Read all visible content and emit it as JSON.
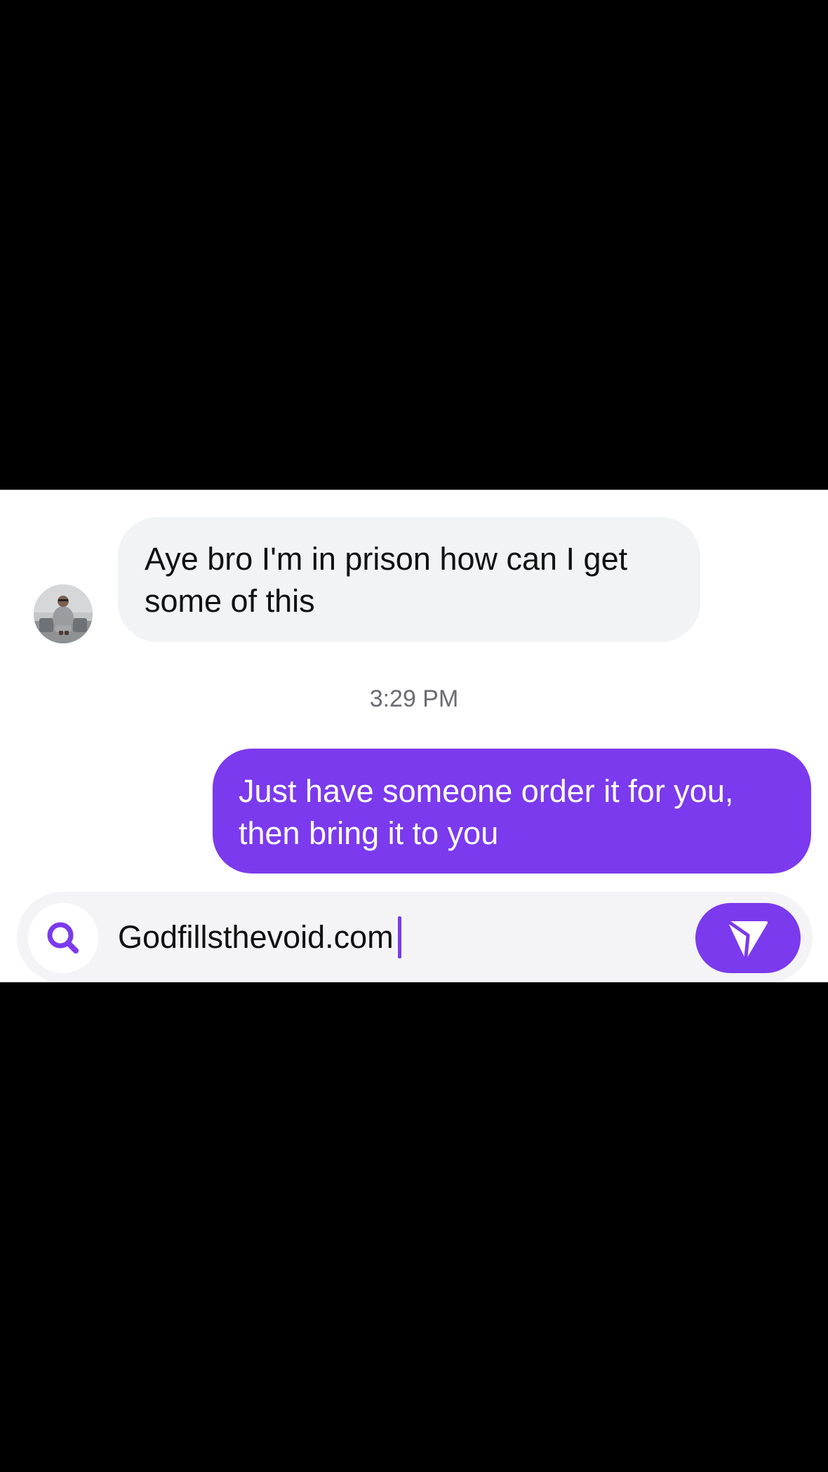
{
  "conversation": {
    "incoming_message": "Aye bro I'm in prison how can I get some of this",
    "timestamp": "3:29 PM",
    "outgoing_message": "Just have someone order it for you, then bring it to you"
  },
  "composer": {
    "input_value": "Godfillsthevoid.com",
    "search_icon": "search-icon",
    "send_icon": "send-icon"
  },
  "colors": {
    "accent": "#7b3aed",
    "incoming_bubble": "#f1f3f4",
    "composer_background": "#f4f4f6",
    "letterbox": "#000000"
  }
}
